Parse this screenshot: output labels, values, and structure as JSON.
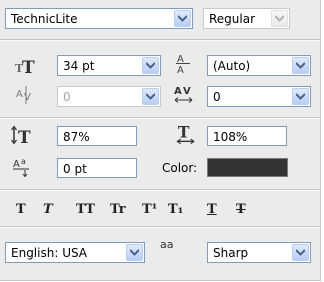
{
  "font": {
    "family": "TechnicLite",
    "style": "Regular"
  },
  "size": {
    "font_size": "34 pt",
    "leading": "(Auto)",
    "kerning": "0",
    "tracking": "0"
  },
  "scale": {
    "vertical": "87%",
    "horizontal": "108%",
    "baseline_shift": "0 pt",
    "color_label": "Color:",
    "color_value": "#333333"
  },
  "format_buttons": [
    "T",
    "T",
    "TT",
    "Tr",
    "T¹",
    "T₁",
    "T",
    "T"
  ],
  "bottom": {
    "language": "English: USA",
    "aa_label": "aa",
    "anti_alias": "Sharp"
  }
}
